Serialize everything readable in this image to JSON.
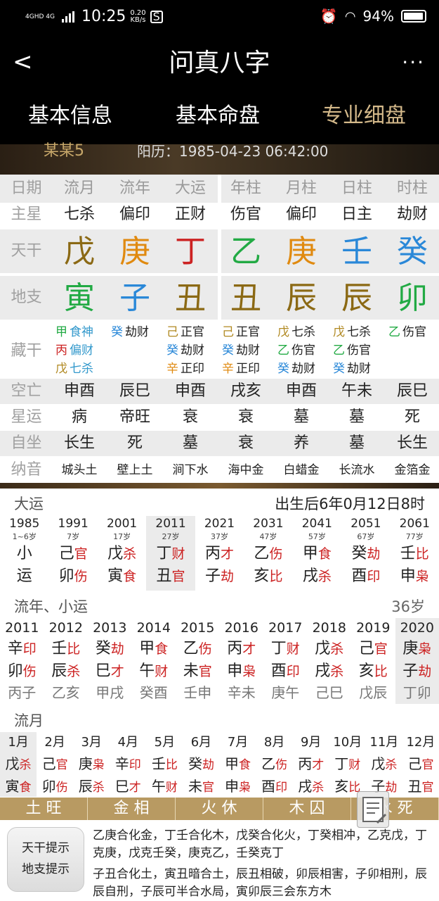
{
  "status": {
    "net": "4GHD 4G",
    "time": "10:25",
    "speed": "0.20",
    "speed_unit": "KB/s",
    "battery": "94%"
  },
  "header": {
    "back": "<",
    "title": "问真八字",
    "more": "···",
    "tabs": [
      "基本信息",
      "基本命盘",
      "专业细盘"
    ],
    "active_tab": 2
  },
  "banner": {
    "name": "某某5",
    "date": "阳历：1985-04-23 06:42:00"
  },
  "grid": {
    "labels": [
      "日期",
      "主星",
      "天干",
      "地支",
      "藏干",
      "空亡",
      "星运",
      "自坐",
      "纳音"
    ],
    "cols": [
      {
        "head": "流月",
        "star": "七杀",
        "tg": "戊",
        "tg_color": "#8b6914",
        "dz": "寅",
        "dz_color": "#22aa44",
        "cg": [
          {
            "c": "甲",
            "cc": "#22aa44",
            "t": "食神",
            "tc": "#3399cc"
          },
          {
            "c": "丙",
            "cc": "#cc2222",
            "t": "偏财",
            "tc": "#3399cc"
          },
          {
            "c": "戊",
            "cc": "#b08820",
            "t": "七杀",
            "tc": "#3399cc"
          }
        ],
        "ky": "申酉",
        "xy": "病",
        "zz": "长生",
        "ny": "城头土"
      },
      {
        "head": "流年",
        "star": "偏印",
        "tg": "庚",
        "tg_color": "#e08a10",
        "dz": "子",
        "dz_color": "#2a88d8",
        "cg": [
          {
            "c": "癸",
            "cc": "#2a88d8",
            "t": "劫财",
            "tc": "#222"
          }
        ],
        "ky": "辰巳",
        "xy": "帝旺",
        "zz": "死",
        "ny": "壁上土"
      },
      {
        "head": "大运",
        "star": "正财",
        "tg": "丁",
        "tg_color": "#cc2222",
        "dz": "丑",
        "dz_color": "#8b6914",
        "cg": [
          {
            "c": "己",
            "cc": "#b08820",
            "t": "正官",
            "tc": "#222"
          },
          {
            "c": "癸",
            "cc": "#2a88d8",
            "t": "劫财",
            "tc": "#222"
          },
          {
            "c": "辛",
            "cc": "#e08a10",
            "t": "正印",
            "tc": "#222"
          }
        ],
        "ky": "申酉",
        "xy": "衰",
        "zz": "墓",
        "ny": "涧下水"
      },
      {
        "head": "年柱",
        "star": "伤官",
        "tg": "乙",
        "tg_color": "#22aa44",
        "dz": "丑",
        "dz_color": "#8b6914",
        "cg": [
          {
            "c": "己",
            "cc": "#b08820",
            "t": "正官",
            "tc": "#222"
          },
          {
            "c": "癸",
            "cc": "#2a88d8",
            "t": "劫财",
            "tc": "#222"
          },
          {
            "c": "辛",
            "cc": "#e08a10",
            "t": "正印",
            "tc": "#222"
          }
        ],
        "ky": "戌亥",
        "xy": "衰",
        "zz": "衰",
        "ny": "海中金"
      },
      {
        "head": "月柱",
        "star": "偏印",
        "tg": "庚",
        "tg_color": "#e08a10",
        "dz": "辰",
        "dz_color": "#8b6914",
        "cg": [
          {
            "c": "戊",
            "cc": "#b08820",
            "t": "七杀",
            "tc": "#222"
          },
          {
            "c": "乙",
            "cc": "#22aa44",
            "t": "伤官",
            "tc": "#222"
          },
          {
            "c": "癸",
            "cc": "#2a88d8",
            "t": "劫财",
            "tc": "#222"
          }
        ],
        "ky": "申酉",
        "xy": "墓",
        "zz": "养",
        "ny": "白蜡金"
      },
      {
        "head": "日柱",
        "star": "日主",
        "tg": "壬",
        "tg_color": "#2a88d8",
        "dz": "辰",
        "dz_color": "#8b6914",
        "cg": [
          {
            "c": "戊",
            "cc": "#b08820",
            "t": "七杀",
            "tc": "#222"
          },
          {
            "c": "乙",
            "cc": "#22aa44",
            "t": "伤官",
            "tc": "#222"
          },
          {
            "c": "癸",
            "cc": "#2a88d8",
            "t": "劫财",
            "tc": "#222"
          }
        ],
        "ky": "午未",
        "xy": "墓",
        "zz": "墓",
        "ny": "长流水"
      },
      {
        "head": "时柱",
        "star": "劫财",
        "tg": "癸",
        "tg_color": "#2a88d8",
        "dz": "卯",
        "dz_color": "#22aa44",
        "cg": [
          {
            "c": "乙",
            "cc": "#22aa44",
            "t": "伤官",
            "tc": "#222"
          }
        ],
        "ky": "辰巳",
        "xy": "死",
        "zz": "长生",
        "ny": "金箔金"
      }
    ]
  },
  "dayun": {
    "title": "大运",
    "start": "出生后6年0月12日8时",
    "items": [
      {
        "year": "1985",
        "age": "1~6岁",
        "top": "小",
        "top_c": "#222",
        "ts": "",
        "bot": "运",
        "bot_c": "#222",
        "bs": ""
      },
      {
        "year": "1991",
        "age": "7岁",
        "top": "己",
        "ts": "官",
        "bot": "卯",
        "bs": "伤"
      },
      {
        "year": "2001",
        "age": "17岁",
        "top": "戊",
        "ts": "杀",
        "bot": "寅",
        "bs": "食"
      },
      {
        "year": "2011",
        "age": "27岁",
        "top": "丁",
        "ts": "财",
        "bot": "丑",
        "bs": "官"
      },
      {
        "year": "2021",
        "age": "37岁",
        "top": "丙",
        "ts": "才",
        "bot": "子",
        "bs": "劫"
      },
      {
        "year": "2031",
        "age": "47岁",
        "top": "乙",
        "ts": "伤",
        "bot": "亥",
        "bs": "比"
      },
      {
        "year": "2041",
        "age": "57岁",
        "top": "甲",
        "ts": "食",
        "bot": "戌",
        "bs": "杀"
      },
      {
        "year": "2051",
        "age": "67岁",
        "top": "癸",
        "ts": "劫",
        "bot": "酉",
        "bs": "印"
      },
      {
        "year": "2061",
        "age": "77岁",
        "top": "壬",
        "ts": "比",
        "bot": "申",
        "bs": "枭"
      }
    ],
    "selected": 3
  },
  "liunian": {
    "title": "流年、小运",
    "age": "36岁",
    "items": [
      {
        "year": "2011",
        "top": "辛",
        "ts": "印",
        "bot": "卯",
        "bs": "伤",
        "xy": "丙子"
      },
      {
        "year": "2012",
        "top": "壬",
        "ts": "比",
        "bot": "辰",
        "bs": "杀",
        "xy": "乙亥"
      },
      {
        "year": "2013",
        "top": "癸",
        "ts": "劫",
        "bot": "巳",
        "bs": "才",
        "xy": "甲戌"
      },
      {
        "year": "2014",
        "top": "甲",
        "ts": "食",
        "bot": "午",
        "bs": "财",
        "xy": "癸酉"
      },
      {
        "year": "2015",
        "top": "乙",
        "ts": "伤",
        "bot": "未",
        "bs": "官",
        "xy": "壬申"
      },
      {
        "year": "2016",
        "top": "丙",
        "ts": "才",
        "bot": "申",
        "bs": "枭",
        "xy": "辛未"
      },
      {
        "year": "2017",
        "top": "丁",
        "ts": "财",
        "bot": "酉",
        "bs": "印",
        "xy": "庚午"
      },
      {
        "year": "2018",
        "top": "戊",
        "ts": "杀",
        "bot": "戌",
        "bs": "杀",
        "xy": "己巳"
      },
      {
        "year": "2019",
        "top": "己",
        "ts": "官",
        "bot": "亥",
        "bs": "比",
        "xy": "戊辰"
      },
      {
        "year": "2020",
        "top": "庚",
        "ts": "枭",
        "bot": "子",
        "bs": "劫",
        "xy": "丁卯"
      }
    ],
    "selected": 9
  },
  "liuyue": {
    "title": "流月",
    "items": [
      {
        "m": "1月",
        "top": "戊",
        "ts": "杀",
        "bot": "寅",
        "bs": "食"
      },
      {
        "m": "2月",
        "top": "己",
        "ts": "官",
        "bot": "卯",
        "bs": "伤"
      },
      {
        "m": "3月",
        "top": "庚",
        "ts": "枭",
        "bot": "辰",
        "bs": "杀"
      },
      {
        "m": "4月",
        "top": "辛",
        "ts": "印",
        "bot": "巳",
        "bs": "才"
      },
      {
        "m": "5月",
        "top": "壬",
        "ts": "比",
        "bot": "午",
        "bs": "财"
      },
      {
        "m": "6月",
        "top": "癸",
        "ts": "劫",
        "bot": "未",
        "bs": "官"
      },
      {
        "m": "7月",
        "top": "甲",
        "ts": "食",
        "bot": "申",
        "bs": "枭"
      },
      {
        "m": "8月",
        "top": "乙",
        "ts": "伤",
        "bot": "酉",
        "bs": "印"
      },
      {
        "m": "9月",
        "top": "丙",
        "ts": "才",
        "bot": "戌",
        "bs": "杀"
      },
      {
        "m": "10月",
        "top": "丁",
        "ts": "财",
        "bot": "亥",
        "bs": "比"
      },
      {
        "m": "11月",
        "top": "戊",
        "ts": "杀",
        "bot": "子",
        "bs": "劫"
      },
      {
        "m": "12月",
        "top": "己",
        "ts": "官",
        "bot": "丑",
        "bs": "官"
      }
    ],
    "selected": 0
  },
  "wuxing": [
    "土 旺",
    "金 相",
    "火 休",
    "木 囚",
    "水 死"
  ],
  "hints": {
    "button_line1": "天干提示",
    "button_line2": "地支提示",
    "tiangan": "乙庚合化金，丁壬合化木，戊癸合化火，丁癸相冲，乙克戊，丁克庚，戊克壬癸，庚克乙，壬癸克丁",
    "dizhi": "子丑合化土，寅丑暗合土，辰丑相破，卯辰相害，子卯相刑，辰辰自刑，子辰可半合水局，寅卯辰三会东方木"
  },
  "colors": {
    "accent": "#b89a62",
    "ss_red": "#cc2222",
    "header_bg": "#000000"
  }
}
